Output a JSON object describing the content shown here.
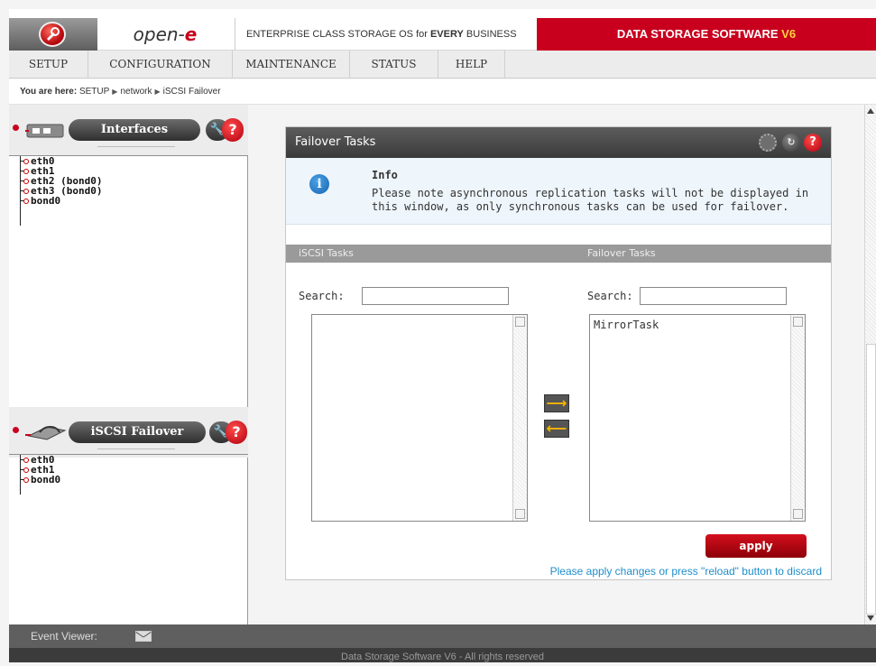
{
  "header": {
    "brand_prefix": "open-",
    "brand_suffix": "e",
    "tagline_prefix": "ENTERPRISE CLASS STORAGE OS for ",
    "tagline_bold": "EVERY",
    "tagline_suffix": " BUSINESS",
    "product_name": "DATA STORAGE SOFTWARE ",
    "product_version": "V6"
  },
  "menu": {
    "items": [
      "SETUP",
      "CONFIGURATION",
      "MAINTENANCE",
      "STATUS",
      "HELP"
    ]
  },
  "breadcrumb": {
    "label": "You are here:",
    "path": [
      "SETUP",
      "network",
      "iSCSI Failover"
    ]
  },
  "sidebar": {
    "interfaces": {
      "title": "Interfaces",
      "items": [
        "eth0",
        "eth1",
        "eth2 (bond0)",
        "eth3 (bond0)",
        "bond0"
      ]
    },
    "iscsi_failover": {
      "title": "iSCSI Failover",
      "items": [
        "eth0",
        "eth1",
        "bond0"
      ]
    },
    "icons": {
      "wrench": "wrench-icon",
      "help": "help-icon"
    }
  },
  "panel": {
    "title": "Failover Tasks",
    "info": {
      "title": "Info",
      "text": "Please note asynchronous replication tasks will not be displayed in this window, as only synchronous tasks can be used for failover."
    },
    "columns": {
      "left": "iSCSI Tasks",
      "right": "Failover Tasks"
    },
    "search": {
      "left_label": "Search:",
      "right_label": "Search:",
      "left_value": "",
      "right_value": ""
    },
    "lists": {
      "left": [],
      "right": [
        "MirrorTask"
      ]
    },
    "apply_label": "apply",
    "apply_note": "Please apply changes or press \"reload\" button to discard"
  },
  "footer": {
    "event_viewer": "Event Viewer:",
    "copyright": "Data Storage Software V6 - All rights reserved"
  },
  "colors": {
    "accent_red": "#c8001e",
    "header_dark": "#3a3a3a",
    "link_blue": "#1f8ecb",
    "arrow_yellow": "#f4b400"
  }
}
